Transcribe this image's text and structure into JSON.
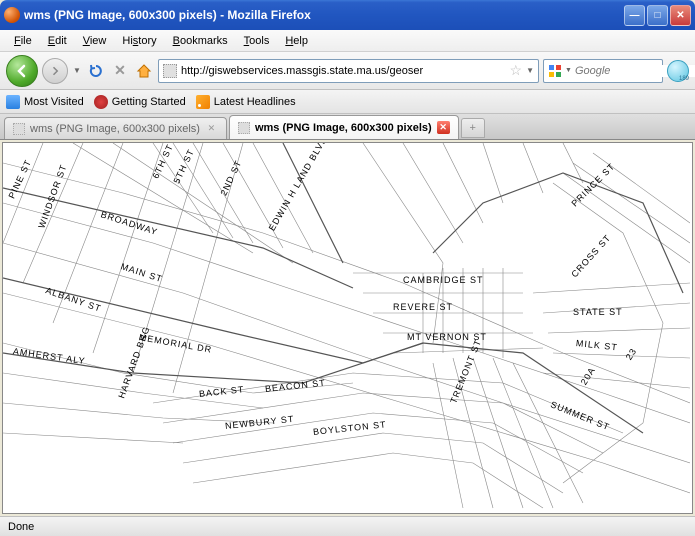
{
  "window": {
    "title": "wms (PNG Image, 600x300 pixels) - Mozilla Firefox"
  },
  "menu": {
    "file": "File",
    "edit": "Edit",
    "view": "View",
    "history": "History",
    "bookmarks": "Bookmarks",
    "tools": "Tools",
    "help": "Help"
  },
  "nav": {
    "url": "http://giswebservices.massgis.state.ma.us/geoser",
    "search_placeholder": "Google"
  },
  "bookmarks": {
    "most_visited": "Most Visited",
    "getting_started": "Getting Started",
    "latest_headlines": "Latest Headlines"
  },
  "tabs": {
    "tab1": "wms (PNG Image, 600x300 pixels)",
    "tab2": "wms (PNG Image, 600x300 pixels)"
  },
  "map_labels": {
    "pine_st": "PINE ST",
    "windsor_st": "WINDSOR ST",
    "broadway": "BROADWAY",
    "sixth_st": "6TH ST",
    "fifth_st": "5TH ST",
    "second_st": "2ND ST",
    "edwin_land": "EDWIN H LAND BLVD",
    "main_st": "MAIN ST",
    "albany_st": "ALBANY ST",
    "amherst": "AMHERST ALY",
    "memorial": "MEMORIAL DR",
    "harvard": "HARVARD BRG",
    "back_st": "BACK ST",
    "beacon_st": "BEACON ST",
    "newbury": "NEWBURY ST",
    "boylston": "BOYLSTON ST",
    "cambridge": "CAMBRIDGE ST",
    "revere": "REVERE ST",
    "mt_vernon": "MT VERNON ST",
    "tremont": "TREMONT ST",
    "prince": "PRINCE ST",
    "cross": "CROSS ST",
    "state": "STATE ST",
    "milk": "MILK ST",
    "summer": "SUMMER ST",
    "r23": "23",
    "r20a": "20A"
  },
  "status": {
    "text": "Done"
  }
}
